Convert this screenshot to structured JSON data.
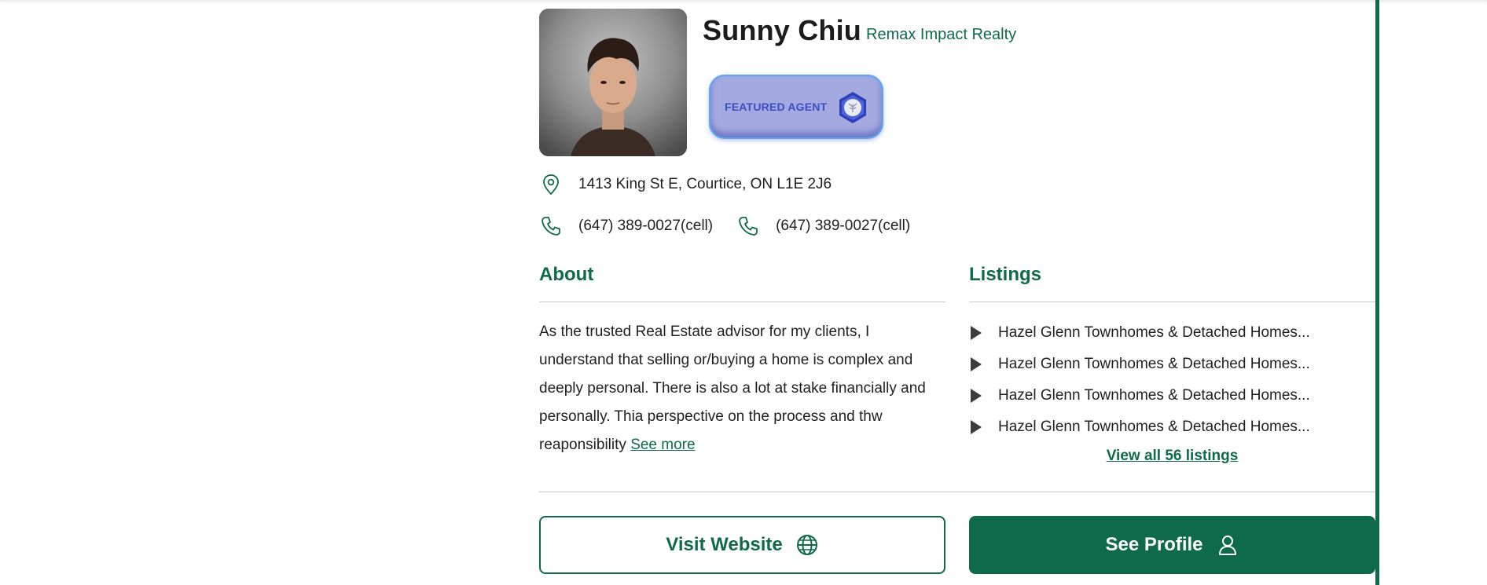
{
  "agent": {
    "name": "Sunny Chiu",
    "brokerage": "Remax Impact Realty",
    "badge_label": "FEATURED AGENT",
    "address": "1413 King St E, Courtice, ON L1E 2J6",
    "phones": [
      "(647) 389-0027(cell)",
      "(647) 389-0027(cell)"
    ]
  },
  "about": {
    "title": "About",
    "text": "As the trusted Real Estate advisor for my clients, I understand that selling or/buying a home is complex and deeply personal. There is also a lot at stake financially and personally. Thia perspective on the process and thw reaponsibility",
    "see_more": "See more"
  },
  "listings": {
    "title": "Listings",
    "items": [
      "Hazel Glenn Townhomes & Detached Homes...",
      "Hazel Glenn Townhomes & Detached Homes...",
      "Hazel Glenn Townhomes & Detached Homes...",
      "Hazel Glenn Townhomes & Detached Homes..."
    ],
    "view_all": "View all 56 listings"
  },
  "buttons": {
    "visit_website": "Visit Website",
    "see_profile": "See Profile"
  },
  "icons": {
    "address": "location-pin-icon",
    "phone": "phone-icon",
    "website": "globe-icon",
    "profile": "user-icon",
    "listing": "play-arrow-icon",
    "badge": "featured-badge-icon"
  },
  "colors": {
    "accent": "#0f6a4b",
    "badge_bg": "#a4a9e0",
    "badge_text": "#3a4fc7"
  }
}
